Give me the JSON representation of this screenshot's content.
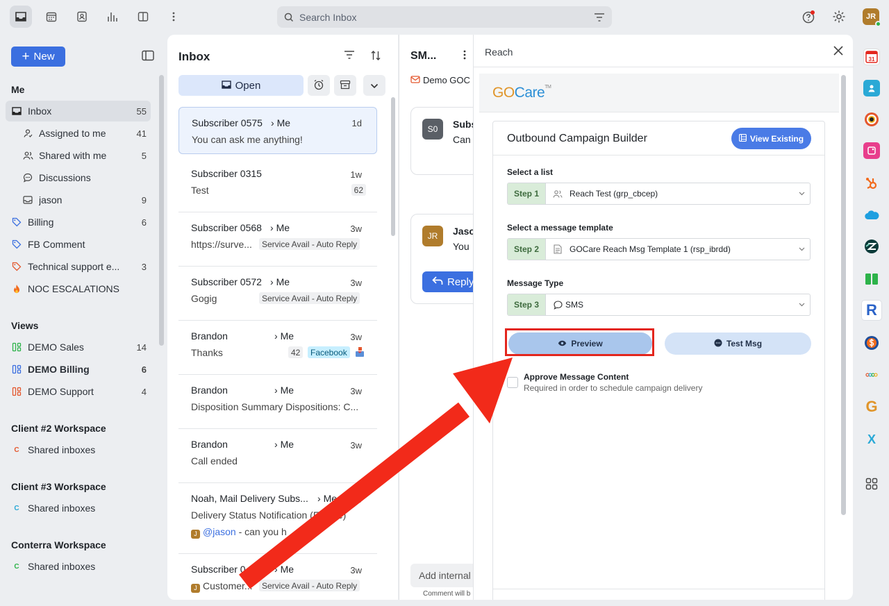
{
  "topbar": {
    "search_placeholder": "Search Inbox",
    "user_initials": "JR"
  },
  "sidebar": {
    "new_label": "New",
    "me_heading": "Me",
    "items": [
      {
        "label": "Inbox",
        "count": "55"
      },
      {
        "label": "Assigned to me",
        "count": "41"
      },
      {
        "label": "Shared with me",
        "count": "5"
      },
      {
        "label": "Discussions",
        "count": ""
      },
      {
        "label": "jason",
        "count": "9"
      },
      {
        "label": "Billing",
        "count": "6"
      },
      {
        "label": "FB Comment",
        "count": ""
      },
      {
        "label": "Technical support e...",
        "count": "3"
      },
      {
        "label": "NOC ESCALATIONS",
        "count": ""
      }
    ],
    "views_heading": "Views",
    "views": [
      {
        "label": "DEMO Sales",
        "count": "14"
      },
      {
        "label": "DEMO Billing",
        "count": "6"
      },
      {
        "label": "DEMO Support",
        "count": "4"
      }
    ],
    "workspaces": [
      {
        "heading": "Client #2 Workspace",
        "label": "Shared inboxes",
        "badge": "C",
        "color": "#e4572e"
      },
      {
        "heading": "Client #3 Workspace",
        "label": "Shared inboxes",
        "badge": "C",
        "color": "#2aa9d6"
      },
      {
        "heading": "Conterra Workspace",
        "label": "Shared inboxes",
        "badge": "C",
        "color": "#2db34a"
      }
    ]
  },
  "inbox": {
    "title": "Inbox",
    "open_label": "Open",
    "conversations": [
      {
        "who": "Subscriber 0575",
        "to": "Me",
        "age": "1d",
        "snippet": "You can ask me anything!",
        "tag": "",
        "count": ""
      },
      {
        "who": "Subscriber 0315",
        "to": "",
        "age": "1w",
        "snippet": "Test",
        "tag": "",
        "count": "62"
      },
      {
        "who": "Subscriber 0568",
        "to": "Me",
        "age": "3w",
        "snippet": "https://surve...",
        "tag": "Service Avail - Auto Reply",
        "count": ""
      },
      {
        "who": "Subscriber 0572",
        "to": "Me",
        "age": "3w",
        "snippet": "Gogig",
        "tag": "Service Avail - Auto Reply",
        "count": ""
      },
      {
        "who": "Brandon",
        "to": "Me",
        "age": "3w",
        "snippet": "Thanks",
        "tag": "Facebook",
        "count": "42"
      },
      {
        "who": "Brandon",
        "to": "Me",
        "age": "3w",
        "snippet": "Disposition Summary Dispositions: C...",
        "tag": "",
        "count": ""
      },
      {
        "who": "Brandon",
        "to": "Me",
        "age": "3w",
        "snippet": "Call ended",
        "tag": "",
        "count": ""
      },
      {
        "who": "Noah, Mail Delivery Subs...",
        "to": "Me",
        "age": "3w",
        "snippet": "Delivery Status Notification (Failure)",
        "sub_mention": "@jason",
        "sub_text": " - can you h",
        "tag": "",
        "count": ""
      },
      {
        "who": "Subscriber 0",
        "to": "Me",
        "age": "3w",
        "snippet": "Customer...",
        "tag": "Service Avail - Auto Reply",
        "count": ""
      }
    ]
  },
  "conversation": {
    "title": "SM...",
    "channel": "Demo GOC",
    "msg1_initials": "S0",
    "msg1_name": "Subs",
    "msg1_text": "Can",
    "msg2_initials": "JR",
    "msg2_name": "Jaso",
    "msg2_text": "You",
    "reply_label": "Reply",
    "note_placeholder": "Add internal",
    "note_hint": "Comment will b"
  },
  "reach": {
    "title": "Reach",
    "logo_go": "GO",
    "logo_care": "Care",
    "logo_tm": "TM",
    "builder_title": "Outbound Campaign Builder",
    "view_existing": "View Existing",
    "fields": [
      {
        "label": "Select a list",
        "step": "Step 1",
        "value": "Reach Test (grp_cbcep)"
      },
      {
        "label": "Select a message template",
        "step": "Step 2",
        "value": "GOCare Reach Msg Template 1 (rsp_ibrdd)"
      },
      {
        "label": "Message Type",
        "step": "Step 3",
        "value": "SMS"
      }
    ],
    "preview_label": "Preview",
    "test_label": "Test Msg",
    "approve_title": "Approve Message Content",
    "approve_sub": "Required in order to schedule campaign delivery"
  },
  "rail": {
    "calendar_day": "31",
    "r_letter": "R",
    "g_letter": "G",
    "x_letter": "X"
  },
  "colors": {
    "accent": "#3b6fe0",
    "highlight": "#e3261d",
    "arrow": "#f22a1a"
  }
}
